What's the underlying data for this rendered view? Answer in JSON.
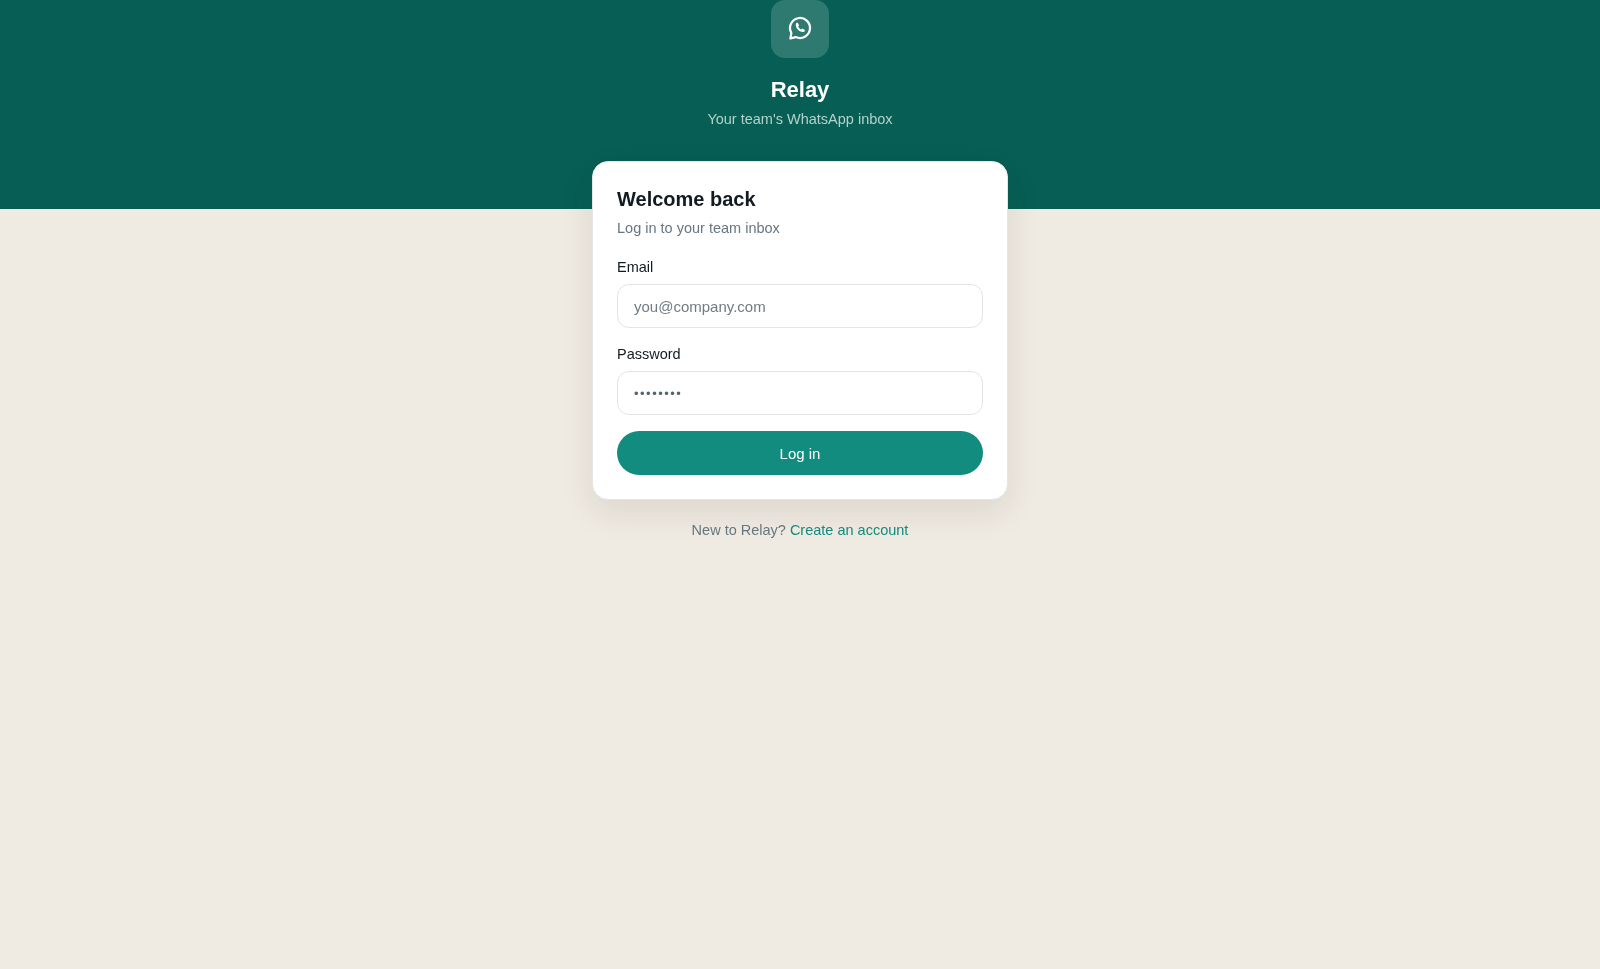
{
  "brand": {
    "name": "Relay",
    "tagline": "Your team's WhatsApp inbox"
  },
  "login_card": {
    "title": "Welcome back",
    "subtitle": "Log in to your team inbox",
    "fields": [
      {
        "kind": "email",
        "label": "Email",
        "placeholder": "you@company.com"
      },
      {
        "kind": "password",
        "label": "Password",
        "value": "••••••••"
      }
    ],
    "submit_button": "Log in"
  },
  "signup_prompt": {
    "text": "New to Relay?",
    "link": "Create an account"
  }
}
